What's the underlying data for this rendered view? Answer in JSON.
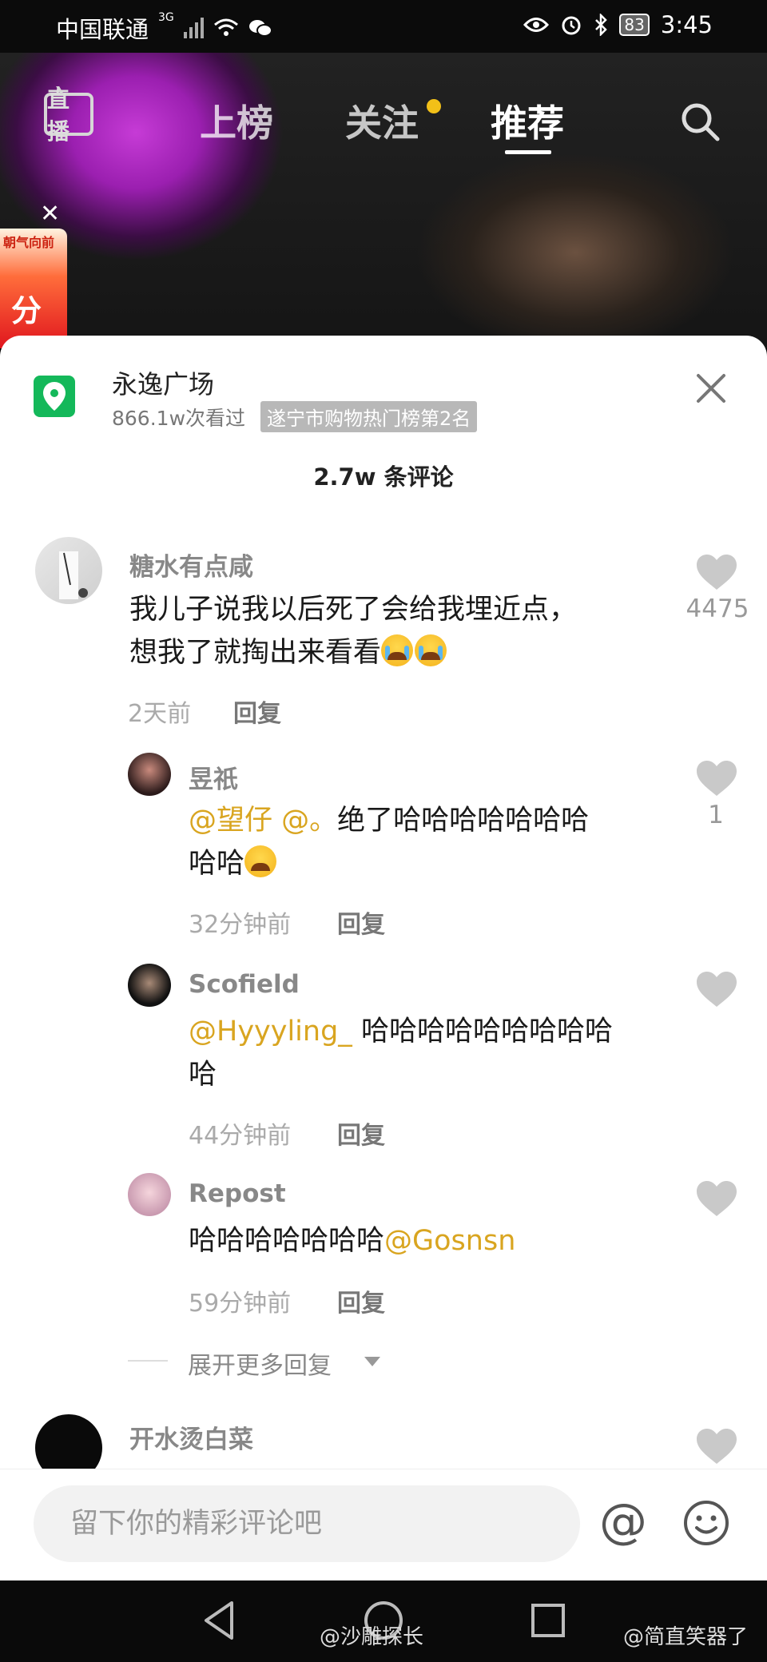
{
  "status": {
    "carrier": "中国联通",
    "network": "3G",
    "battery": "83",
    "time": "3:45"
  },
  "topnav": {
    "live": "直播",
    "tabs": [
      "上榜",
      "关注",
      "推荐"
    ],
    "active_tab": "推荐"
  },
  "ad": {
    "tag": "朝气向前",
    "amount_char": "分"
  },
  "location": {
    "name": "永逸广场",
    "views": "866.1w次看过",
    "rank": "遂宁市购物热门榜第2名"
  },
  "comment_count": "2.7w 条评论",
  "comments": [
    {
      "user": "糖水有点咸",
      "line1": "我儿子说我以后死了会给我埋近点，",
      "line2": "想我了就掏出来看看",
      "time": "2天前",
      "reply": "回复",
      "likes": "4475"
    },
    {
      "user": "昱祇",
      "mention": "@望仔 @。",
      "line1_rest": "绝了哈哈哈哈哈哈哈",
      "line2": "哈哈",
      "time": "32分钟前",
      "reply": "回复",
      "likes": "1"
    },
    {
      "user": "Scofield",
      "mention": "@Hyyyling_",
      "line1_rest": " 哈哈哈哈哈哈哈哈哈",
      "line2": "哈",
      "time": "44分钟前",
      "reply": "回复",
      "likes": ""
    },
    {
      "user": "Repost",
      "text": "哈哈哈哈哈哈哈",
      "mention": "@Gosnsn",
      "time": "59分钟前",
      "reply": "回复",
      "likes": ""
    },
    {
      "user": "开水烫白菜"
    }
  ],
  "expand_more": "展开更多回复",
  "input_placeholder": "留下你的精彩评论吧",
  "at_symbol": "@",
  "watermarks": [
    "@沙雕探长",
    "@简直笑器了"
  ],
  "colors": {
    "mention": "#d9a520",
    "location_icon": "#14b85a",
    "notify_dot": "#f2c018"
  }
}
